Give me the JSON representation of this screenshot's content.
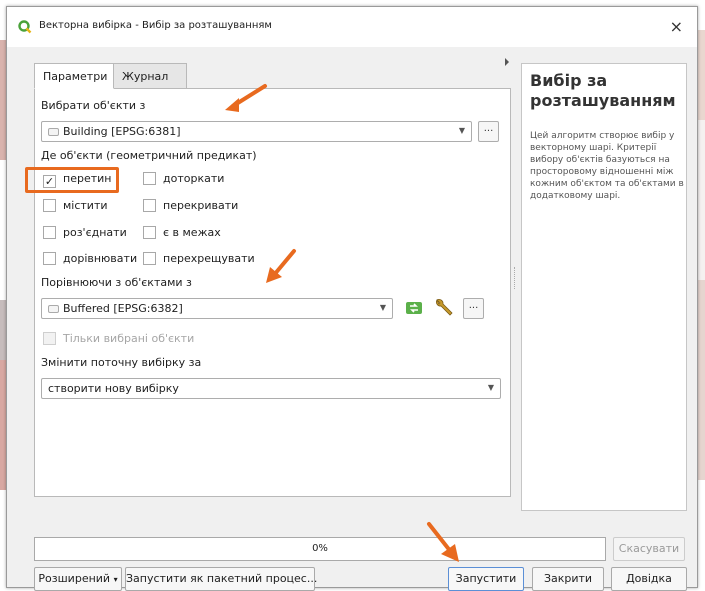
{
  "window": {
    "title": "Векторна вибірка - Вибір за розташуванням",
    "close_glyph": "×",
    "app_icon": "qgis-icon"
  },
  "tabs": [
    {
      "label": "Параметри",
      "active": true
    },
    {
      "label": "Журнал",
      "active": false
    }
  ],
  "params": {
    "select_label": "Вибрати об'єкти з",
    "select_layer": "Building [EPSG:6381]",
    "predicate_label": "Де об'єкти (геометричний предикат)",
    "predicates": [
      {
        "label": "перетин",
        "checked": true
      },
      {
        "label": "доторкати",
        "checked": false
      },
      {
        "label": "містити",
        "checked": false
      },
      {
        "label": "перекривати",
        "checked": false
      },
      {
        "label": "роз'єднати",
        "checked": false
      },
      {
        "label": "є в межах",
        "checked": false
      },
      {
        "label": "дорівнювати",
        "checked": false
      },
      {
        "label": "перехрещувати",
        "checked": false
      }
    ],
    "compare_label": "Порівнюючи з об'єктами з",
    "compare_layer": "Buffered [EPSG:6382]",
    "selected_only_label": "Тільки вибрані об'єкти",
    "modify_label": "Змінити поточну вибірку за",
    "modify_value": "створити нову вибірку",
    "dots": "..."
  },
  "help": {
    "title": "Вибір за розташуванням",
    "text": "Цей алгоритм створює вибір у векторному шарі. Критерії вибору об'єктів базуються на просторовому відношенні між кожним об'єктом та об'єктами в додатковому шарі."
  },
  "progress": {
    "text": "0%",
    "value": 0
  },
  "buttons": {
    "cancel": "Скасувати",
    "advanced": "Розширений",
    "advanced_caret": "▾",
    "batch": "Запустити як пакетний процес...",
    "run": "Запустити",
    "close": "Закрити",
    "help": "Довідка"
  },
  "colors": {
    "highlight": "#e86a1f",
    "annotation_arrow": "#e86a1f",
    "qgis_green": "#4aa23a"
  }
}
